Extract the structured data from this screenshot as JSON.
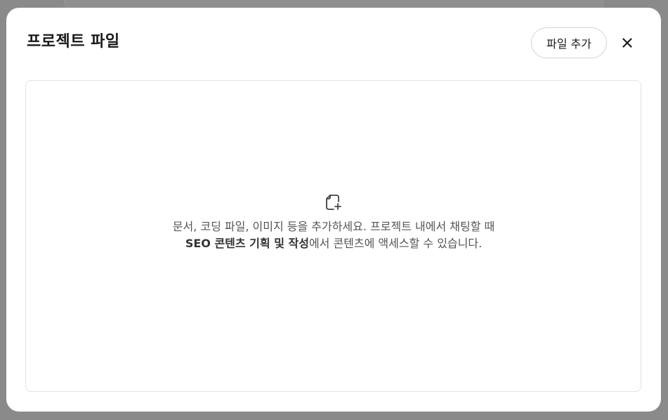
{
  "modal": {
    "title": "프로젝트 파일",
    "add_file_label": "파일 추가",
    "close_label": "×"
  },
  "empty_state": {
    "icon": "file-add-icon",
    "text_before": "문서, 코딩 파일, 이미지 등을 추가하세요. 프로젝트 내에서 채팅할 때 ",
    "project_name": "SEO 콘텐츠 기획 및 작성",
    "text_after": "에서 콘텐츠에 액세스할 수 있습니다."
  }
}
